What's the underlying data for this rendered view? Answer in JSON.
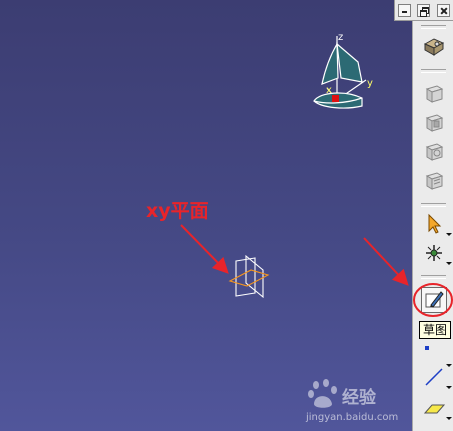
{
  "canvas": {
    "background_top": "#3c3d72",
    "background_bottom": "#51569b"
  },
  "window_controls": {
    "minimize_icon": "minimize-icon",
    "restore_icon": "restore-icon",
    "close_icon": "close-icon"
  },
  "compass": {
    "axis_z": "z",
    "axis_x": "x",
    "axis_y": "y"
  },
  "annotation": {
    "label": "xy平面",
    "color": "#e8242a"
  },
  "toolbar": {
    "buttons": [
      {
        "name": "part-design-workbench",
        "icon": "workbench-icon"
      },
      {
        "name": "pad",
        "icon": "pad-icon"
      },
      {
        "name": "pocket",
        "icon": "pocket-icon"
      },
      {
        "name": "shaft",
        "icon": "shaft-icon"
      },
      {
        "name": "groove",
        "icon": "groove-icon"
      },
      {
        "name": "select",
        "icon": "select-arrow-icon"
      },
      {
        "name": "snap",
        "icon": "snap-icon"
      },
      {
        "name": "sketch",
        "icon": "sketch-icon"
      },
      {
        "name": "point",
        "icon": "point-icon"
      },
      {
        "name": "line",
        "icon": "line-icon"
      },
      {
        "name": "plane",
        "icon": "plane-icon"
      }
    ],
    "tooltip": "草图"
  },
  "watermark": {
    "brand": "经验",
    "url": "jingyan.baidu.com"
  }
}
